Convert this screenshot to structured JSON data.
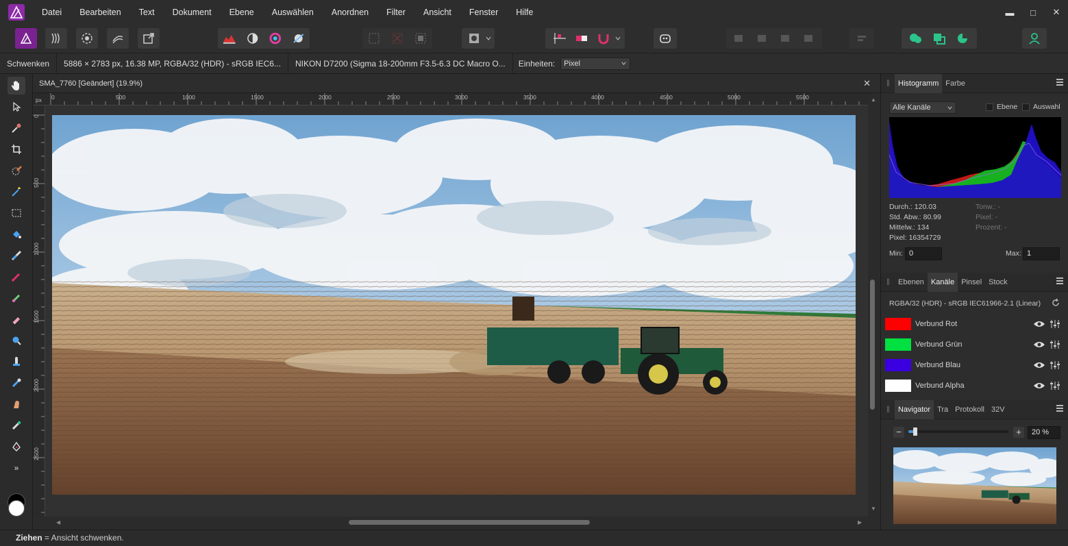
{
  "menu": {
    "items": [
      "Datei",
      "Bearbeiten",
      "Text",
      "Dokument",
      "Ebene",
      "Auswählen",
      "Anordnen",
      "Filter",
      "Ansicht",
      "Fenster",
      "Hilfe"
    ]
  },
  "window_controls": {
    "minimize": "▬",
    "maximize": "□",
    "close": "✕"
  },
  "toolbar": {
    "personas": [
      "photo-persona",
      "liquify-persona",
      "develop-persona",
      "tone-mapping-persona",
      "export-persona"
    ],
    "groups": [
      "histogram-adjust",
      "auto-contrast",
      "auto-color",
      "auto-white-balance",
      "quick-mask",
      "mask-subtract",
      "mask-intersect",
      "selection-mode",
      "snap-toggle",
      "guide-toggle",
      "assistant",
      "arrange",
      "align",
      "boolean-ops",
      "user"
    ]
  },
  "context": {
    "tool_name": "Schwenken",
    "doc_info": "5886 × 2783 px, 16.38 MP, RGBA/32 (HDR) - sRGB IEC6...",
    "camera_info": "NIKON D7200 (Sigma 18-200mm F3.5-6.3 DC Macro O...",
    "units_label": "Einheiten:",
    "units_value": "Pixel"
  },
  "document": {
    "title": "SMA_7760 [Geändert] (19.9%)",
    "close": "✕",
    "ruler_unit": "px",
    "ruler_top": [
      "0",
      "500",
      "1000",
      "1500",
      "2000",
      "2500",
      "3000",
      "3500",
      "4000",
      "4500",
      "5000",
      "5500"
    ],
    "ruler_left": [
      "0",
      "500",
      "1000",
      "1500",
      "2000",
      "2500"
    ]
  },
  "status": {
    "key": "Ziehen",
    "text": " = Ansicht schwenken."
  },
  "histogram_panel": {
    "tabs": [
      "Histogramm",
      "Farbe"
    ],
    "channel_select": "Alle Kanäle",
    "opt_layer": "Ebene",
    "opt_selection": "Auswahl",
    "stats_left": [
      "Durch.: 120.03",
      "Std. Abw.: 80.99",
      "Mittelw.: 134",
      "Pixel: 16354729"
    ],
    "stats_right": [
      "Tonw.: -",
      "Pixel: -",
      "Prozent: -"
    ],
    "min_label": "Min:",
    "min_value": "0",
    "max_label": "Max:",
    "max_value": "1"
  },
  "channels_panel": {
    "tabs": [
      "Ebenen",
      "Kanäle",
      "Pinsel",
      "Stock"
    ],
    "format": "RGBA/32 (HDR) - sRGB IEC61966-2.1 (Linear)",
    "channels": [
      {
        "label": "Verbund Rot",
        "color": "#ff0000"
      },
      {
        "label": "Verbund Grün",
        "color": "#00e040"
      },
      {
        "label": "Verbund Blau",
        "color": "#3a00e0"
      },
      {
        "label": "Verbund Alpha",
        "color": "#ffffff"
      }
    ]
  },
  "navigator_panel": {
    "tabs": [
      "Navigator",
      "Tra",
      "Protokoll",
      "32V"
    ],
    "zoom_minus": "−",
    "zoom_plus": "+",
    "zoom_value": "20 %",
    "zoom_level": 0.2
  },
  "colors": {
    "accent": "#c526d8",
    "green_ui": "#2bc48a",
    "panel_bg": "#2d2d2d"
  }
}
